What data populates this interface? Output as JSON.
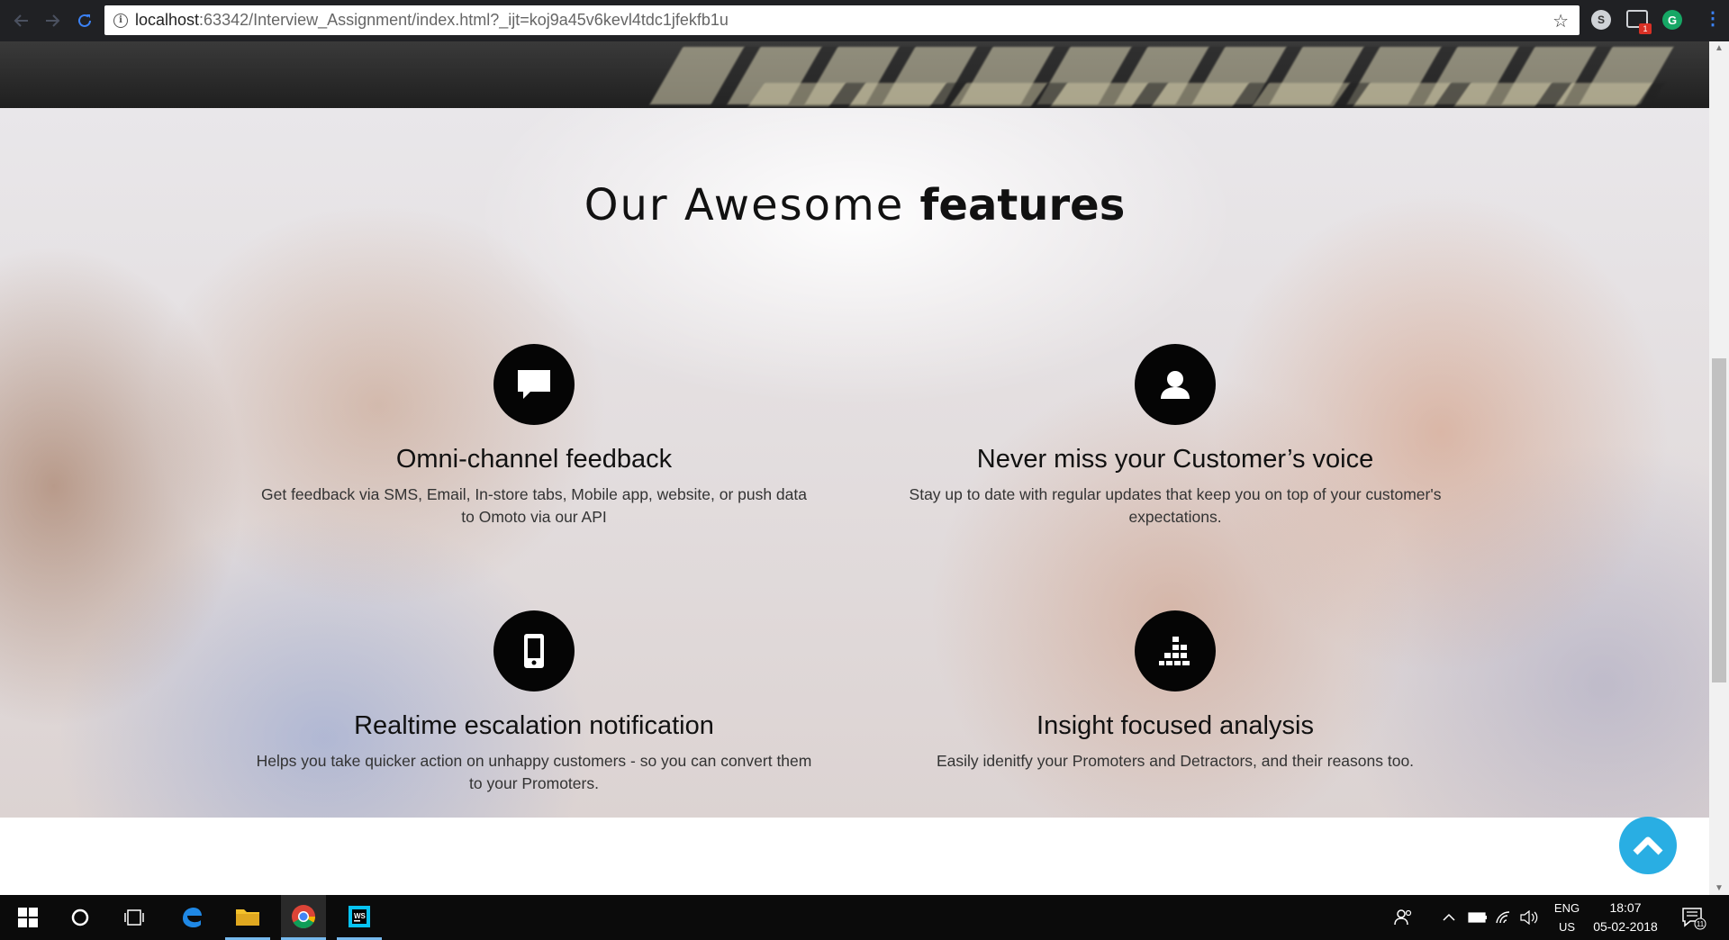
{
  "browser": {
    "url_host": "localhost",
    "url_rest": ":63342/Interview_Assignment/index.html?_ijt=koj9a45v6kevl4tdc1jfekfb1u",
    "extension_badge": "1"
  },
  "features_section": {
    "heading_light": "Our Awesome",
    "heading_bold": "features",
    "items": [
      {
        "icon": "chat-icon",
        "title": "Omni-channel feedback",
        "text": "Get feedback via SMS, Email, In-store tabs, Mobile app, website, or push data to Omoto via our API"
      },
      {
        "icon": "user-icon",
        "title": "Never miss your Customer’s voice",
        "text": "Stay up to date with regular updates that keep you on top of your customer's expectations."
      },
      {
        "icon": "mobile-icon",
        "title": "Realtime escalation notification",
        "text": "Helps you take quicker action on unhappy customers - so you can convert them to your Promoters."
      },
      {
        "icon": "bar-chart-icon",
        "title": "Insight focused analysis",
        "text": "Easily idenitfy your Promoters and Detractors, and their reasons too."
      }
    ]
  },
  "taskbar": {
    "lang_top": "ENG",
    "lang_bottom": "US",
    "time": "18:07",
    "date": "05-02-2018",
    "notification_count": "11"
  },
  "colors": {
    "scroll_top_button": "#29aee3",
    "icon_circle": "#050505"
  }
}
